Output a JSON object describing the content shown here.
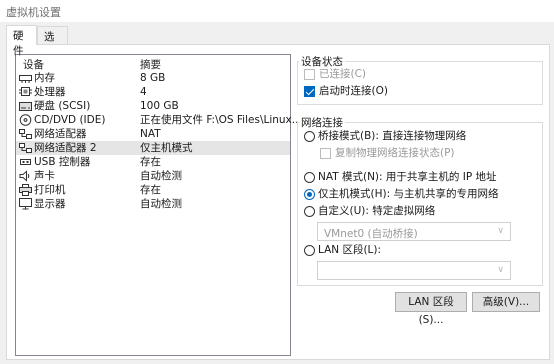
{
  "window": {
    "title": "虚拟机设置"
  },
  "tabs": [
    {
      "label": "硬件",
      "active": true
    },
    {
      "label": "选项",
      "active": false
    }
  ],
  "device_list": {
    "columns": [
      "设备",
      "摘要"
    ],
    "rows": [
      {
        "name": "内存",
        "summary": "8 GB",
        "icon": "memory-icon"
      },
      {
        "name": "处理器",
        "summary": "4",
        "icon": "processor-icon"
      },
      {
        "name": "硬盘 (SCSI)",
        "summary": "100 GB",
        "icon": "hard-disk-icon"
      },
      {
        "name": "CD/DVD (IDE)",
        "summary": "正在使用文件 F:\\OS Files\\Linux...",
        "icon": "cd-dvd-icon"
      },
      {
        "name": "网络适配器",
        "summary": "NAT",
        "icon": "network-adapter-icon"
      },
      {
        "name": "网络适配器 2",
        "summary": "仅主机模式",
        "icon": "network-adapter-icon",
        "selected": true
      },
      {
        "name": "USB 控制器",
        "summary": "存在",
        "icon": "usb-icon"
      },
      {
        "name": "声卡",
        "summary": "自动检测",
        "icon": "sound-card-icon"
      },
      {
        "name": "打印机",
        "summary": "存在",
        "icon": "printer-icon"
      },
      {
        "name": "显示器",
        "summary": "自动检测",
        "icon": "display-icon"
      }
    ]
  },
  "device_status": {
    "title": "设备状态",
    "connected": {
      "label": "已连接(C)",
      "checked": false,
      "disabled": true
    },
    "connect_at_power_on": {
      "label": "启动时连接(O)",
      "checked": true
    }
  },
  "network_connection": {
    "title": "网络连接",
    "bridged": {
      "label": "桥接模式(B): 直接连接物理网络",
      "selected": false
    },
    "replicate_state": {
      "label": "复制物理网络连接状态(P)",
      "checked": false,
      "disabled": true
    },
    "nat": {
      "label": "NAT 模式(N): 用于共享主机的 IP 地址",
      "selected": false
    },
    "host_only": {
      "label": "仅主机模式(H): 与主机共享的专用网络",
      "selected": true
    },
    "custom": {
      "label": "自定义(U): 特定虚拟网络",
      "selected": false
    },
    "custom_select_value": "VMnet0 (自动桥接)",
    "lan_segment": {
      "label": "LAN 区段(L):",
      "selected": false
    },
    "lan_segment_select_value": ""
  },
  "buttons": {
    "lan_segments": "LAN 区段(S)...",
    "advanced": "高级(V)..."
  },
  "colors": {
    "accent": "#0067c0",
    "selection": "#e5e5e5"
  }
}
